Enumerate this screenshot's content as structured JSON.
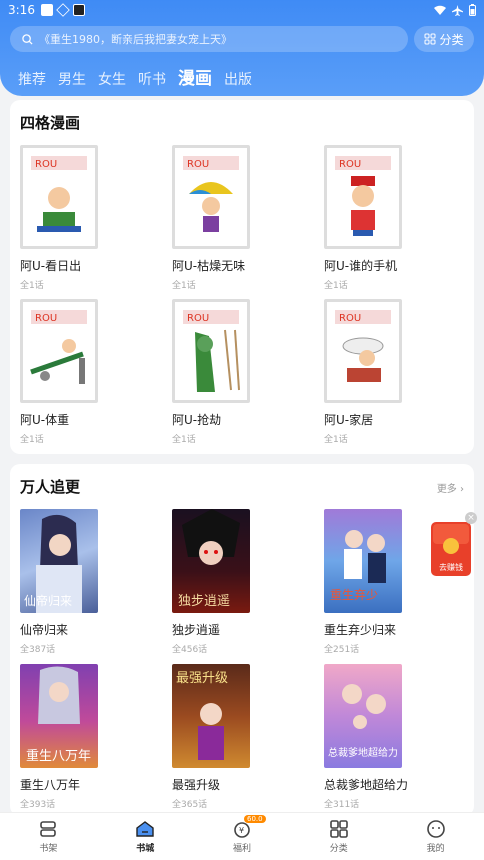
{
  "status": {
    "time": "3:16"
  },
  "search": {
    "placeholder": "《重生1980，断亲后我把妻女宠上天》",
    "category_label": "分类"
  },
  "tabs": [
    {
      "label": "推荐"
    },
    {
      "label": "男生"
    },
    {
      "label": "女生"
    },
    {
      "label": "听书"
    },
    {
      "label": "漫画"
    },
    {
      "label": "出版"
    }
  ],
  "section1": {
    "title": "四格漫画",
    "books": [
      {
        "name": "阿U-看日出",
        "sub": "全1话"
      },
      {
        "name": "阿U-枯燥无味",
        "sub": "全1话"
      },
      {
        "name": "阿U-谁的手机",
        "sub": "全1话"
      },
      {
        "name": "阿U-体重",
        "sub": "全1话"
      },
      {
        "name": "阿U-抢劫",
        "sub": "全1话"
      },
      {
        "name": "阿U-家居",
        "sub": "全1话"
      }
    ]
  },
  "section2": {
    "title": "万人追更",
    "more_label": "更多",
    "books": [
      {
        "name": "仙帝归来",
        "sub": "全387话"
      },
      {
        "name": "独步逍遥",
        "sub": "全456话"
      },
      {
        "name": "重生弃少归来",
        "sub": "全251话"
      },
      {
        "name": "重生八万年",
        "sub": "全393话"
      },
      {
        "name": "最强升级",
        "sub": "全365话"
      },
      {
        "name": "总裁爹地超给力",
        "sub": "全311话"
      }
    ]
  },
  "float_promo": {
    "label": "去赚钱"
  },
  "nav": [
    {
      "label": "书架"
    },
    {
      "label": "书城"
    },
    {
      "label": "福利",
      "badge": "60.0"
    },
    {
      "label": "分类"
    },
    {
      "label": "我的"
    }
  ],
  "colors": {
    "header": "#3f8bf5",
    "accent": "#ff8a00"
  }
}
